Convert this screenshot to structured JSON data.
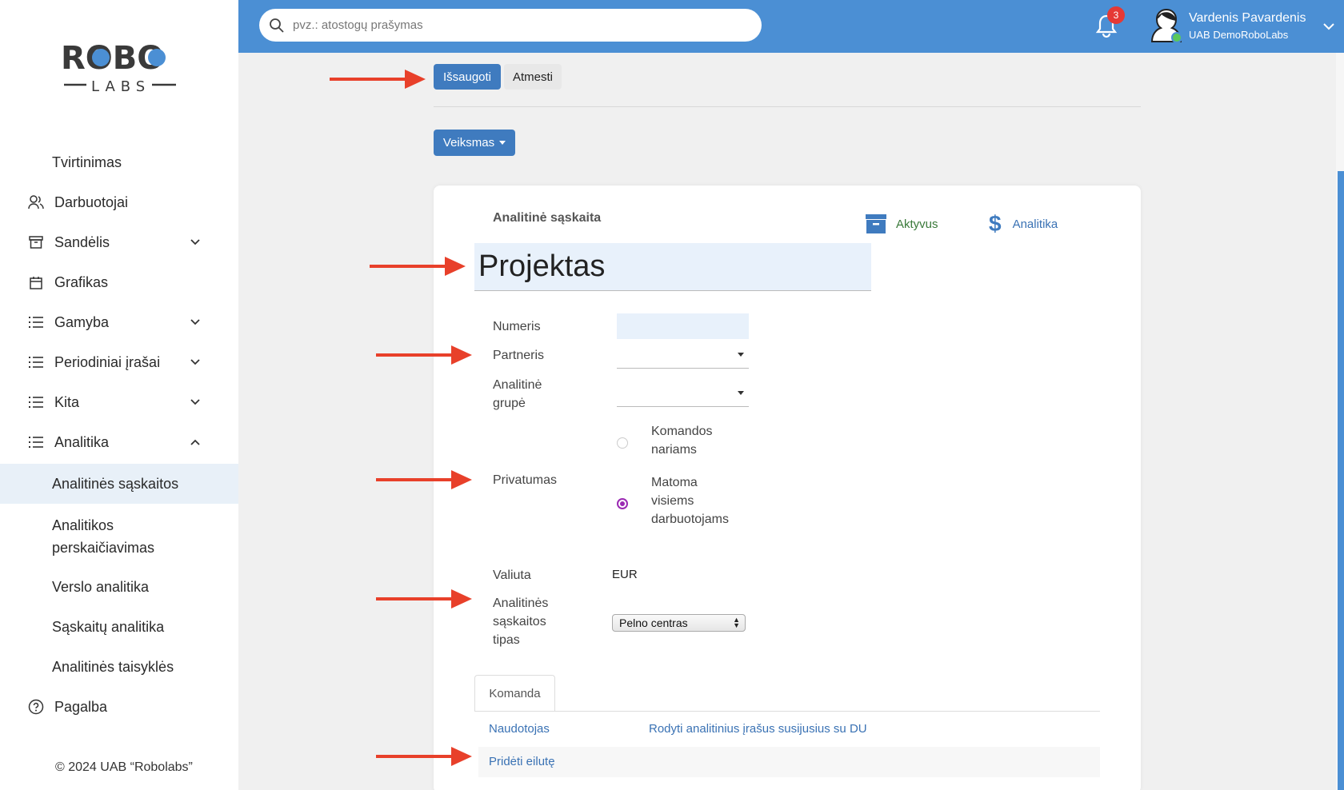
{
  "brand": {
    "logo_top": "ROBO",
    "logo_bottom": "LABS"
  },
  "sidebar": {
    "items": [
      {
        "label": "Tvirtinimas",
        "icon": "none"
      },
      {
        "label": "Darbuotojai",
        "icon": "users-icon"
      },
      {
        "label": "Sandėlis",
        "icon": "archive-icon",
        "expandable": true
      },
      {
        "label": "Grafikas",
        "icon": "calendar-icon"
      },
      {
        "label": "Gamyba",
        "icon": "list-icon",
        "expandable": true
      },
      {
        "label": "Periodiniai įrašai",
        "icon": "list-icon",
        "expandable": true
      },
      {
        "label": "Kita",
        "icon": "list-icon",
        "expandable": true
      },
      {
        "label": "Analitika",
        "icon": "list-icon",
        "expanded": true
      }
    ],
    "subitems": [
      {
        "label": "Analitinės sąskaitos",
        "active": true
      },
      {
        "label_line1": "Analitikos",
        "label_line2": "perskaičiavimas"
      },
      {
        "label": "Verslo analitika"
      },
      {
        "label": "Sąskaitų analitika"
      },
      {
        "label": "Analitinės taisyklės"
      }
    ],
    "help": "Pagalba",
    "copyright": "© 2024 UAB “Robolabs”"
  },
  "topbar": {
    "search_placeholder": "pvz.: atostogų prašymas",
    "notifications_count": "3",
    "user_name": "Vardenis Pavardenis",
    "company": "UAB DemoRoboLabs"
  },
  "actions": {
    "save": "Išsaugoti",
    "discard": "Atmesti",
    "action_menu": "Veiksmas"
  },
  "form": {
    "header_label": "Analitinė sąskaita",
    "stat_active": "Aktyvus",
    "stat_analytics": "Analitika",
    "name": "Projektas",
    "numeris_label": "Numeris",
    "numeris_value": "",
    "partneris_label": "Partneris",
    "grupe_label_1": "Analitinė",
    "grupe_label_2": "grupė",
    "privatumas_label": "Privatumas",
    "privacy_option1_l1": "Komandos",
    "privacy_option1_l2": "nariams",
    "privacy_option2_l1": "Matoma",
    "privacy_option2_l2": "visiems",
    "privacy_option2_l3": "darbuotojams",
    "privacy_selected": "Matoma visiems darbuotojams",
    "valiuta_label": "Valiuta",
    "valiuta_value": "EUR",
    "tipas_label_1": "Analitinės",
    "tipas_label_2": "sąskaitos",
    "tipas_label_3": "tipas",
    "tipas_value": "Pelno centras"
  },
  "tabs": {
    "team_tab": "Komanda",
    "col_user": "Naudotojas",
    "col_du": "Rodyti analitinius įrašus susijusius su DU",
    "add_line": "Pridėti eilutę"
  },
  "colors": {
    "topbar": "#4b8fd4",
    "primary_button": "#3f7bbf",
    "arrow": "#e8402a",
    "radio_selected": "#9b2ab3",
    "active_stat": "#3a7a3a"
  }
}
